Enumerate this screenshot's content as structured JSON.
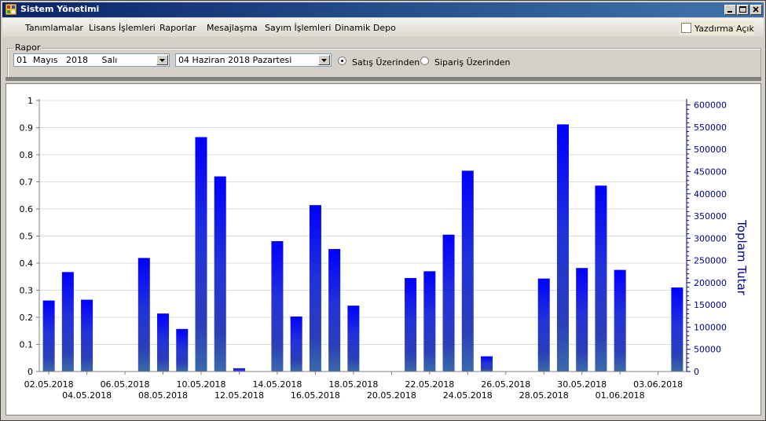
{
  "window": {
    "title": "Sistem Yönetimi"
  },
  "menu": [
    "Tanımlamalar",
    "Lisans İşlemleri",
    "Raporlar",
    "Mesajlaşma",
    "Sayım İşlemleri",
    "Dinamik Depo"
  ],
  "print_toggle": {
    "label": "Yazdırma Açık",
    "checked": false
  },
  "report": {
    "group_label": "Rapor",
    "start_date": "01  Mayıs   2018     Salı",
    "end_date": "04 Haziran 2018 Pazartesi",
    "radio_sales": "Satış Üzerinden",
    "radio_orders": "Sipariş Üzerinden",
    "selected": "sales"
  },
  "chart_data": {
    "type": "bar",
    "title": "",
    "xlabel": "",
    "ylabel_left": "",
    "ylabel_right": "Toplam Tutar",
    "ylim_left": [
      0,
      1
    ],
    "ylim_right": [
      0,
      610000
    ],
    "left_ticks": [
      "0",
      "0.1",
      "0.2",
      "0.3",
      "0.4",
      "0.5",
      "0.6",
      "0.7",
      "0.8",
      "0.9",
      "1"
    ],
    "right_ticks": [
      "0",
      "50000",
      "100000",
      "150000",
      "200000",
      "250000",
      "300000",
      "350000",
      "400000",
      "450000",
      "500000",
      "550000",
      "600000"
    ],
    "x_tick_labels": [
      "02.05.2018",
      "04.05.2018",
      "06.05.2018",
      "08.05.2018",
      "10.05.2018",
      "12.05.2018",
      "14.05.2018",
      "16.05.2018",
      "18.05.2018",
      "20.05.2018",
      "22.05.2018",
      "24.05.2018",
      "26.05.2018",
      "28.05.2018",
      "30.05.2018",
      "01.06.2018",
      "03.06.2018"
    ],
    "grid": true,
    "values": [
      0.262,
      0.367,
      0.265,
      0,
      0,
      0.419,
      0.214,
      0.157,
      0.865,
      0.72,
      0.012,
      0,
      0.481,
      0.203,
      0.614,
      0.452,
      0.243,
      0,
      0,
      0.345,
      0.37,
      0.505,
      0.741,
      0.056,
      0,
      0,
      0.343,
      0.912,
      0.382,
      0.686,
      0.375,
      0,
      0,
      0.31
    ],
    "colors": {
      "top": "#0000ff",
      "mid": "#2a3fd0",
      "bottom": "#3b6aa8",
      "axis_right": "#00008b"
    }
  }
}
